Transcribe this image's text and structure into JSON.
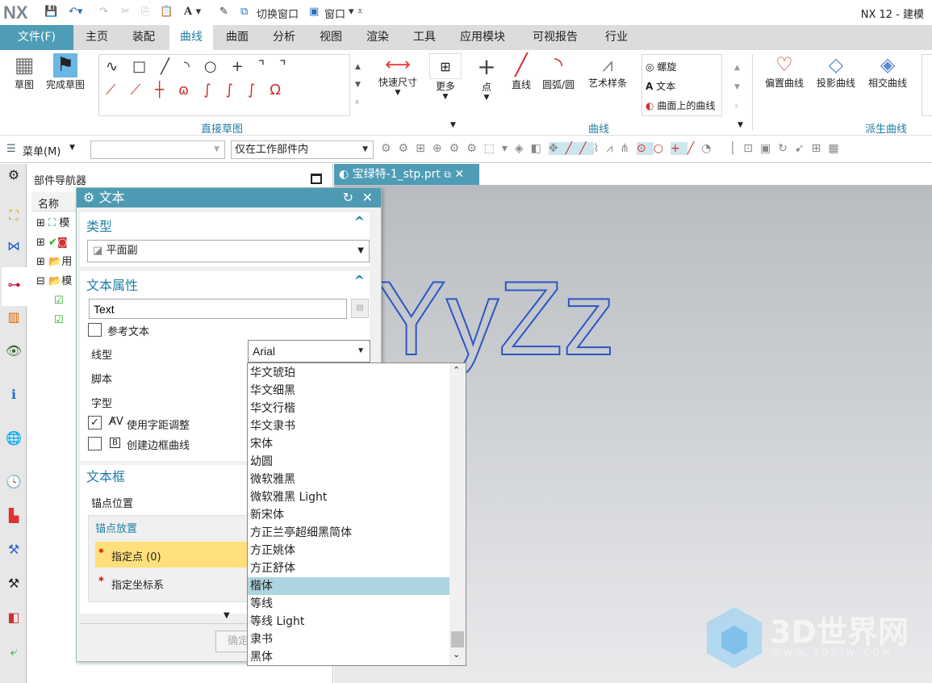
{
  "titlebar": {
    "logo": "NX",
    "switch_window": "切换窗口",
    "window": "窗口",
    "title": "NX 12 - 建模"
  },
  "tabs": {
    "file": "文件(F)",
    "items": [
      "主页",
      "装配",
      "曲线",
      "曲面",
      "分析",
      "视图",
      "渲染",
      "工具",
      "应用模块",
      "可视报告",
      "行业"
    ],
    "active": "曲线"
  },
  "ribbon": {
    "sketch": "草图",
    "finish_sketch": "完成草图",
    "quick_dim": "快速尺寸",
    "more": "更多",
    "group_direct_sketch": "直接草图",
    "point": "点",
    "line": "直线",
    "arc": "圆弧/圆",
    "studio_spline": "艺术样条",
    "helix": "螺旋",
    "text": "文本",
    "curve_on_surface": "曲面上的曲线",
    "group_curve": "曲线",
    "offset_curve": "偏置曲线",
    "project_curve": "投影曲线",
    "intersect_curve": "相交曲线",
    "group_derived": "派生曲线"
  },
  "toolbar": {
    "menu": "菜单(M)",
    "filter_value": "",
    "scope": "仅在工作部件内"
  },
  "navigator": {
    "title": "部件导航器",
    "column": "名称",
    "rows": [
      "模",
      "",
      "用",
      "模"
    ]
  },
  "graphics": {
    "tab": "宝绿特-1_stp.prt",
    "model_text": "oYyZz"
  },
  "dialog": {
    "title": "文本",
    "type_section": "类型",
    "type_value": "平面副",
    "props_section": "文本属性",
    "text_value": "Text",
    "reference_text": "参考文本",
    "font_label": "线型",
    "font_value": "Arial",
    "script_label": "脚本",
    "style_label": "字型",
    "use_kerning": "使用字距调整",
    "use_kerning_checked": true,
    "create_frame": "创建边框曲线",
    "create_frame_checked": false,
    "reference_text_checked": false,
    "frame_section": "文本框",
    "anchor_pos": "锚点位置",
    "anchor_place": "锚点放置",
    "specify_point": "指定点 (0)",
    "specify_csys": "指定坐标系",
    "ok": "确定"
  },
  "font_list": {
    "items": [
      "华文琥珀",
      "华文细黑",
      "华文行楷",
      "华文隶书",
      "宋体",
      "幼圆",
      "微软雅黑",
      "微软雅黑 Light",
      "新宋体",
      "方正兰亭超细黑简体",
      "方正姚体",
      "方正舒体",
      "楷体",
      "等线",
      "等线 Light",
      "隶书",
      "黑体"
    ],
    "highlighted": "楷体"
  },
  "watermark": {
    "brand": "3D世界网",
    "url": "WWW.3DSJW.COM"
  },
  "colors": {
    "accent": "#4e9cb5",
    "highlight": "#add5e0",
    "required": "#ffe07a"
  }
}
